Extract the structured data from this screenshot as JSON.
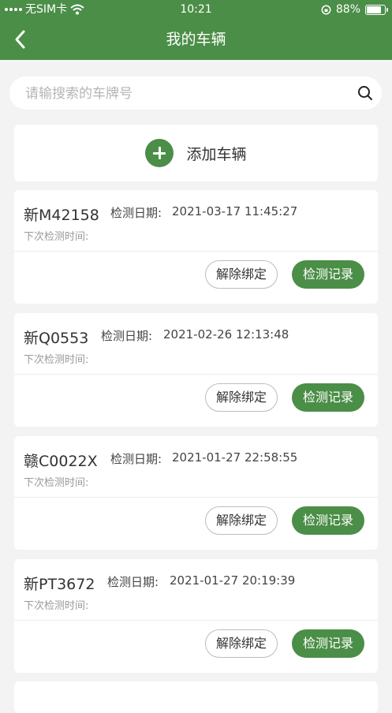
{
  "status_bar": {
    "carrier": "无SIM卡",
    "time": "10:21",
    "battery_text": "88%",
    "battery_level": 0.88
  },
  "navbar": {
    "title": "我的车辆",
    "back_icon": "chevron-left-icon"
  },
  "search": {
    "placeholder": "请输搜索的车牌号",
    "value": "",
    "icon": "search-icon"
  },
  "add_vehicle": {
    "label": "添加车辆",
    "icon": "plus-circle-icon"
  },
  "vehicles": [
    {
      "plate": "新M42158",
      "date_label": "检测日期:",
      "date": "2021-03-17 11:45:27",
      "next_label": "下次检测时间:",
      "unbind_label": "解除绑定",
      "record_label": "检测记录"
    },
    {
      "plate": "新Q0553",
      "date_label": "检测日期:",
      "date": "2021-02-26 12:13:48",
      "next_label": "下次检测时间:",
      "unbind_label": "解除绑定",
      "record_label": "检测记录"
    },
    {
      "plate": "赣C0022X",
      "date_label": "检测日期:",
      "date": "2021-01-27 22:58:55",
      "next_label": "下次检测时间:",
      "unbind_label": "解除绑定",
      "record_label": "检测记录"
    },
    {
      "plate": "新PT3672",
      "date_label": "检测日期:",
      "date": "2021-01-27 20:19:39",
      "next_label": "下次检测时间:",
      "unbind_label": "解除绑定",
      "record_label": "检测记录"
    }
  ],
  "colors": {
    "brand_green": "#4b8e47",
    "background": "#f3f3f3"
  }
}
